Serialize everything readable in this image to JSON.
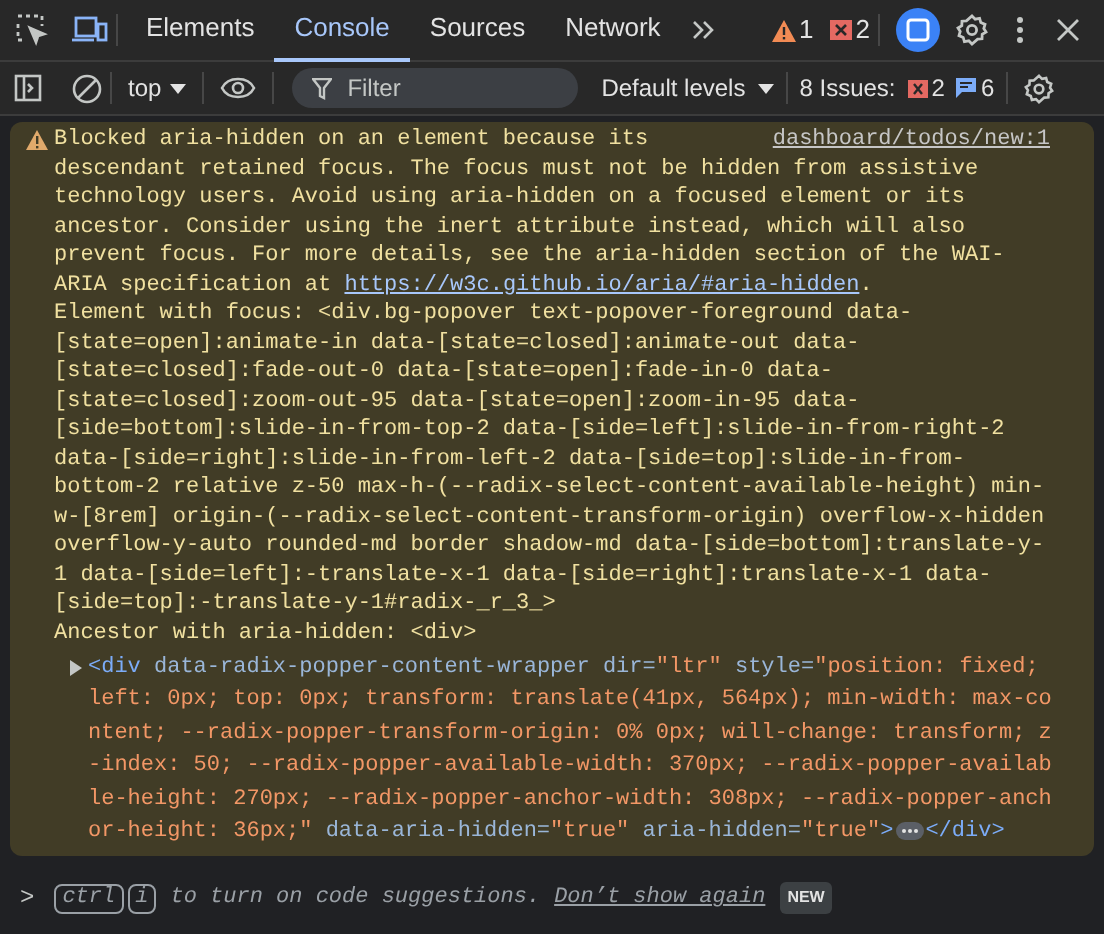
{
  "tabs": [
    {
      "label": "Elements",
      "selected": false
    },
    {
      "label": "Console",
      "selected": true
    },
    {
      "label": "Sources",
      "selected": false
    },
    {
      "label": "Network",
      "selected": false
    }
  ],
  "status": {
    "warnings": "1",
    "errors": "2"
  },
  "console_toolbar": {
    "context": "top",
    "filter": {
      "placeholder": "Filter"
    },
    "levels": "Default levels",
    "issues_label": "8 Issues:",
    "issue_errors": "2",
    "issue_info": "6"
  },
  "messages": [
    {
      "kind": "warning",
      "source": "dashboard/todos/new:1",
      "text_first_line": "Blocked aria-hidden on an element because its",
      "text": "descendant retained focus. The focus must not be hidden from assistive technology users. Avoid using aria-hidden on a focused element or its ancestor. Consider using the inert attribute instead, which will also prevent focus. For more details, see the aria-hidden section of the WAI-ARIA specification at ",
      "link": "https://w3c.github.io/aria/#aria-hidden",
      "text_end": ".",
      "element_with_focus": "Element with focus: <div.bg-popover text-popover-foreground data-[state=open]:animate-in data-[state=closed]:animate-out data-[state=closed]:fade-out-0 data-[state=open]:fade-in-0 data-[state=closed]:zoom-out-95 data-[state=open]:zoom-in-95 data-[side=bottom]:slide-in-from-top-2 data-[side=left]:slide-in-from-right-2 data-[side=right]:slide-in-from-left-2 data-[side=top]:slide-in-from-bottom-2 relative z-50 max-h-(--radix-select-content-available-height) min-w-[8rem] origin-(--radix-select-content-transform-origin) overflow-x-hidden overflow-y-auto rounded-md border shadow-md data-[side=bottom]:translate-y-1 data-[side=left]:-translate-x-1 data-[side=right]:translate-x-1 data-[side=top]:-translate-y-1#radix-_r_3_>",
      "ancestor": "Ancestor with aria-hidden: <div>",
      "node": {
        "expanded": false,
        "parts": [
          {
            "kind": "tag",
            "text": "<div"
          },
          {
            "kind": "attr",
            "text": " data-radix-popper-content-wrapper"
          },
          {
            "kind": "attr",
            "text": " dir="
          },
          {
            "kind": "value",
            "text": "\"ltr\""
          },
          {
            "kind": "attr",
            "text": " style="
          },
          {
            "kind": "value",
            "text": "\"position: fixed; left: 0px; top: 0px; transform: translate(41px, 564px); min-width: max-content; --radix-popper-transform-origin: 0% 0px; will-change: transform; z-index: 50; --radix-popper-available-width: 370px; --radix-popper-available-height: 270px; --radix-popper-anchor-width: 308px; --radix-popper-anchor-height: 36px;\""
          },
          {
            "kind": "attr",
            "text": " data-aria-hidden="
          },
          {
            "kind": "value",
            "text": "\"true\""
          },
          {
            "kind": "attr",
            "text": " aria-hidden="
          },
          {
            "kind": "value",
            "text": "\"true\""
          },
          {
            "kind": "tag",
            "text": ">"
          },
          {
            "kind": "ellipsis"
          },
          {
            "kind": "tag",
            "text": "</div>"
          }
        ]
      }
    }
  ],
  "prompt": {
    "symbol": ">",
    "keys": [
      "ctrl",
      "i"
    ],
    "hint": "to turn on code suggestions.",
    "dismiss_link": "Don’t show again",
    "badge": "NEW"
  }
}
